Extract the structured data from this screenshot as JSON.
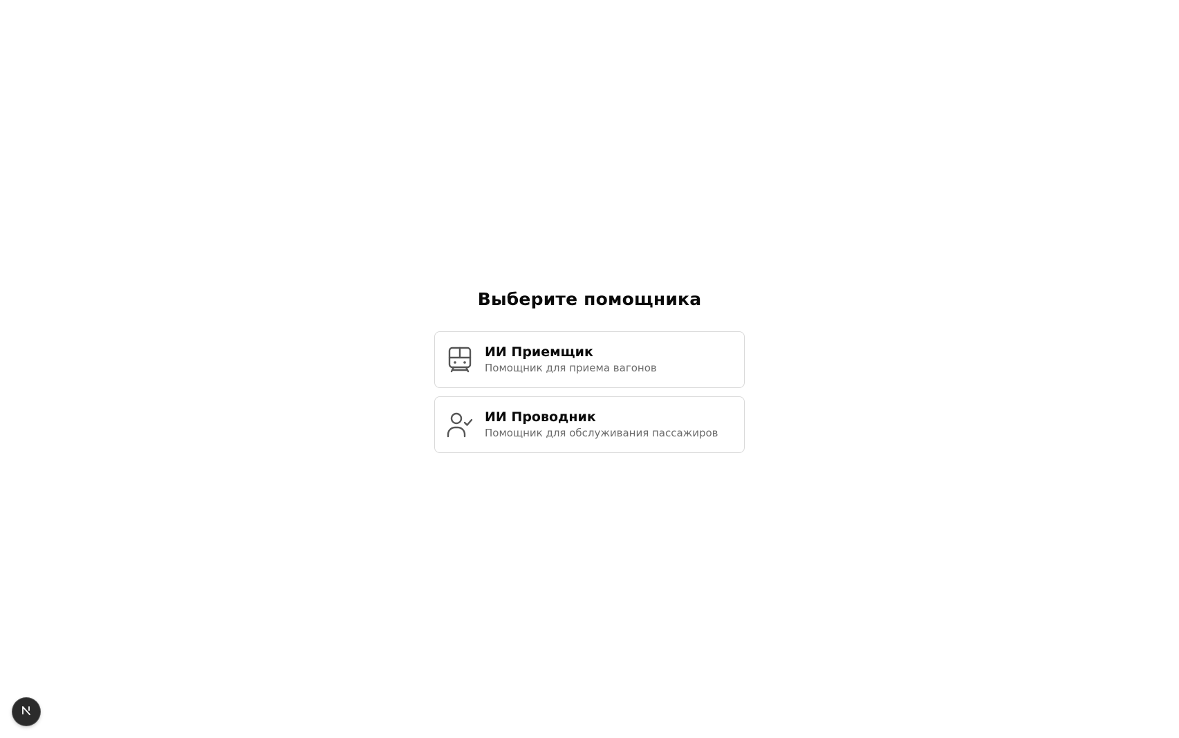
{
  "chooser": {
    "title": "Выберите помощника",
    "options": [
      {
        "icon": "train-icon",
        "title": "ИИ Приемщик",
        "description": "Помощник для приема вагонов"
      },
      {
        "icon": "user-check-icon",
        "title": "ИИ Проводник",
        "description": "Помощник для обслуживания пассажиров"
      }
    ]
  },
  "dev_badge": {
    "icon": "nextjs-logo-icon"
  },
  "colors": {
    "background": "#ffffff",
    "text": "#0a0a0a",
    "muted_text": "#6b6b6b",
    "card_border": "#d9d9d9",
    "icon": "#555555",
    "badge_bg": "#2b2b2b"
  }
}
